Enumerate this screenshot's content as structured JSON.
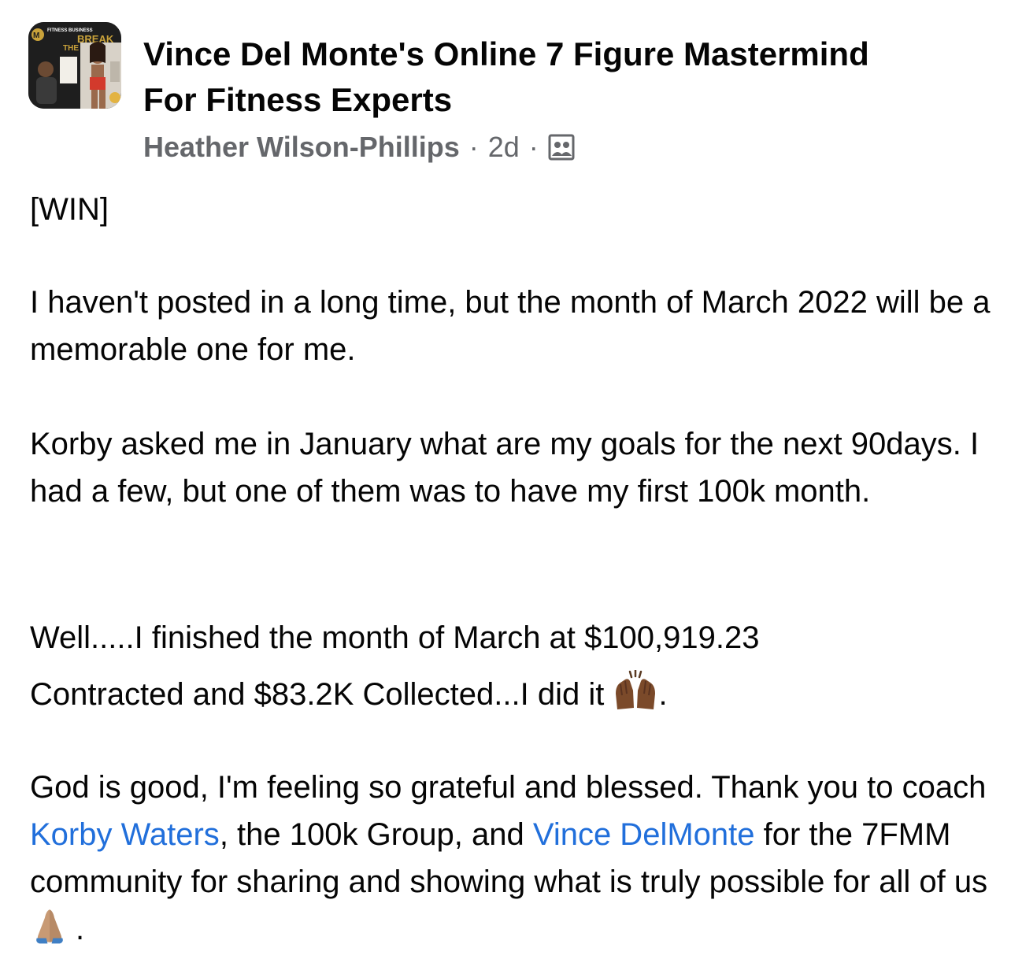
{
  "group": {
    "avatar_text_top": "FITNESS BUSINESS",
    "avatar_text_main": "BREAK",
    "avatar_text_sub": "THE",
    "name_line1": "Vince Del Monte's Online 7 Figure Mastermind",
    "name_line2": "For Fitness Experts"
  },
  "meta": {
    "author": "Heather Wilson-Phillips",
    "separator": "·",
    "time": "2d",
    "separator2": "·",
    "audience_icon": "members-icon"
  },
  "post": {
    "tag": "[WIN]",
    "p1": "I haven't posted in a long time, but the month of March 2022 will be a memorable one for me.",
    "p2": "Korby asked me in January what are my goals for the next 90days. I had a few, but one of them was to have my first 100k month.",
    "p3_line1": "Well.....I finished the month of March at  $100,919.23",
    "p3_line2": "Contracted and $83.2K Collected...I did it",
    "p3_emoji": "raising-hands-emoji",
    "p3_end": ".",
    "p4_a": "God is good, I'm feeling so grateful and blessed. Thank you to coach ",
    "p4_link1": "Korby Waters",
    "p4_b": ", the 100k Group, and ",
    "p4_link2": "Vince DelMonte",
    "p4_c": " for the 7FMM community for sharing and showing what is truly possible for all of us",
    "p4_emoji": "folded-hands-emoji",
    "p4_end": "."
  },
  "colors": {
    "text": "#050505",
    "secondary": "#65676b",
    "link": "#216fdb"
  }
}
